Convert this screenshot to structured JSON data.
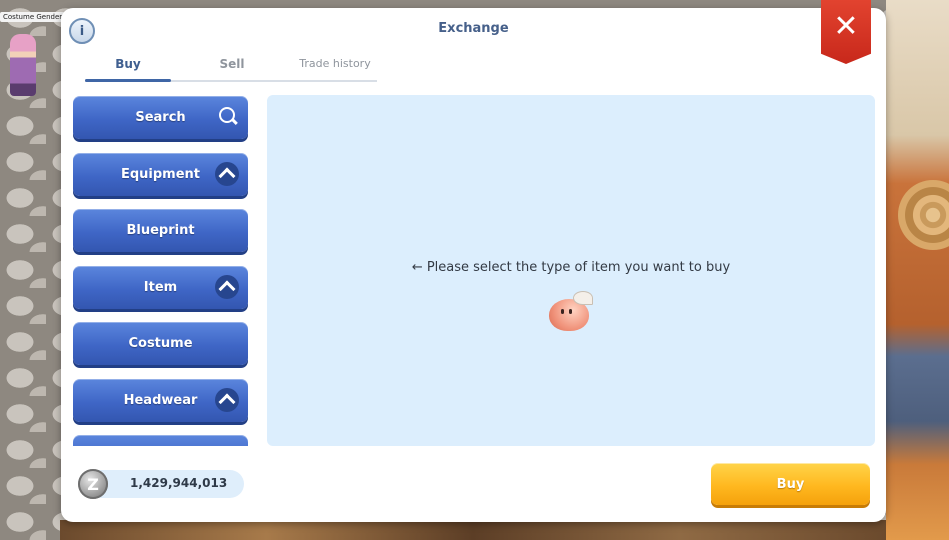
{
  "background": {
    "player_label": "Costume Gender"
  },
  "window": {
    "title": "Exchange",
    "info_icon": "info-icon",
    "close_icon": "close-icon"
  },
  "tabs": [
    {
      "label": "Buy",
      "active": true
    },
    {
      "label": "Sell",
      "active": false
    },
    {
      "label": "Trade history",
      "active": false
    }
  ],
  "categories": [
    {
      "label": "Search",
      "icon": "search-icon"
    },
    {
      "label": "Equipment",
      "icon": "chevron-up-icon"
    },
    {
      "label": "Blueprint"
    },
    {
      "label": "Item",
      "icon": "chevron-up-icon"
    },
    {
      "label": "Costume"
    },
    {
      "label": "Headwear",
      "icon": "chevron-up-icon"
    }
  ],
  "content": {
    "prompt": "← Please select the type of item you want to buy",
    "mascot_icon": "poring-icon"
  },
  "wallet": {
    "currency_icon": "zeny-coin-icon",
    "amount": "1,429,944,013"
  },
  "actions": {
    "buy_label": "Buy"
  },
  "colors": {
    "category_button": "#3f66c6",
    "buy_button": "#ffb81f",
    "close_banner": "#d4311f",
    "content_bg": "#dceefd",
    "title_text": "#46608a"
  }
}
